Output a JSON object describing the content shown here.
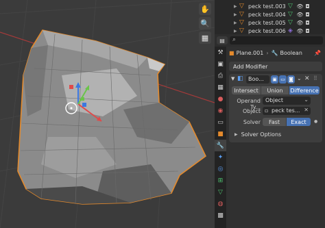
{
  "colors": {
    "accent": "#4772b3",
    "orange": "#e48a2c",
    "green": "#4ec26f",
    "viewport_bg": "#3b3b3b"
  },
  "viewport": {
    "nav_icons": [
      "hand-icon",
      "magnify-icon",
      "grid-icon"
    ]
  },
  "outliner": {
    "items": [
      {
        "label": "peck test.003"
      },
      {
        "label": "peck test.004"
      },
      {
        "label": "peck test.005"
      },
      {
        "label": "peck test.006"
      }
    ]
  },
  "properties": {
    "search_placeholder": "",
    "breadcrumb": {
      "object": "Plane.001",
      "separator": "›",
      "modifier": "Boolean"
    },
    "add_modifier": "Add Modifier",
    "modifier": {
      "name": "Boo...",
      "operations": [
        "Intersect",
        "Union",
        "Difference"
      ],
      "active_operation": "Difference",
      "operand_label": "Operand Ty...",
      "operand_value": "Object",
      "object_label": "Object",
      "object_value": "peck tes...",
      "solver_label": "Solver",
      "solver_options": [
        "Fast",
        "Exact"
      ],
      "active_solver": "Exact",
      "solver_options_section": "Solver Options"
    }
  }
}
